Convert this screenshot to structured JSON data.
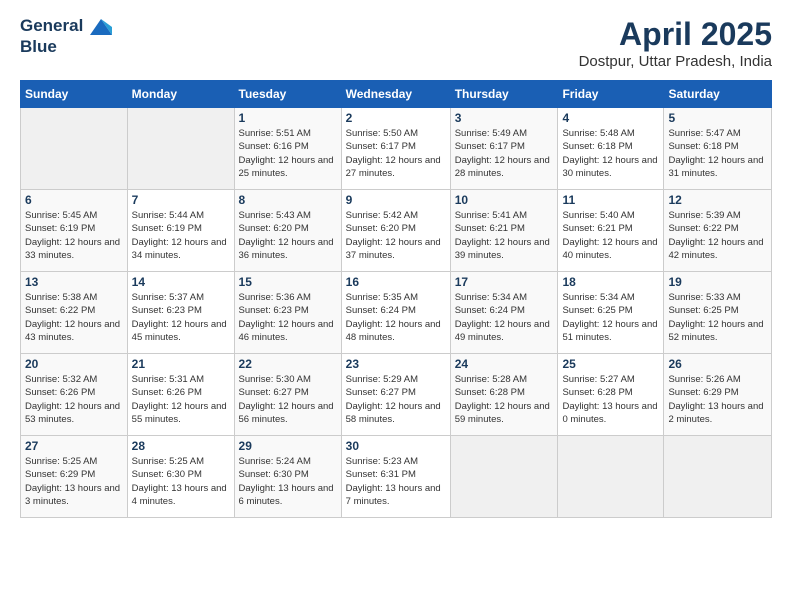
{
  "header": {
    "logo_line1": "General",
    "logo_line2": "Blue",
    "month_title": "April 2025",
    "location": "Dostpur, Uttar Pradesh, India"
  },
  "weekdays": [
    "Sunday",
    "Monday",
    "Tuesday",
    "Wednesday",
    "Thursday",
    "Friday",
    "Saturday"
  ],
  "weeks": [
    [
      {
        "day": "",
        "sunrise": "",
        "sunset": "",
        "daylight": ""
      },
      {
        "day": "",
        "sunrise": "",
        "sunset": "",
        "daylight": ""
      },
      {
        "day": "1",
        "sunrise": "Sunrise: 5:51 AM",
        "sunset": "Sunset: 6:16 PM",
        "daylight": "Daylight: 12 hours and 25 minutes."
      },
      {
        "day": "2",
        "sunrise": "Sunrise: 5:50 AM",
        "sunset": "Sunset: 6:17 PM",
        "daylight": "Daylight: 12 hours and 27 minutes."
      },
      {
        "day": "3",
        "sunrise": "Sunrise: 5:49 AM",
        "sunset": "Sunset: 6:17 PM",
        "daylight": "Daylight: 12 hours and 28 minutes."
      },
      {
        "day": "4",
        "sunrise": "Sunrise: 5:48 AM",
        "sunset": "Sunset: 6:18 PM",
        "daylight": "Daylight: 12 hours and 30 minutes."
      },
      {
        "day": "5",
        "sunrise": "Sunrise: 5:47 AM",
        "sunset": "Sunset: 6:18 PM",
        "daylight": "Daylight: 12 hours and 31 minutes."
      }
    ],
    [
      {
        "day": "6",
        "sunrise": "Sunrise: 5:45 AM",
        "sunset": "Sunset: 6:19 PM",
        "daylight": "Daylight: 12 hours and 33 minutes."
      },
      {
        "day": "7",
        "sunrise": "Sunrise: 5:44 AM",
        "sunset": "Sunset: 6:19 PM",
        "daylight": "Daylight: 12 hours and 34 minutes."
      },
      {
        "day": "8",
        "sunrise": "Sunrise: 5:43 AM",
        "sunset": "Sunset: 6:20 PM",
        "daylight": "Daylight: 12 hours and 36 minutes."
      },
      {
        "day": "9",
        "sunrise": "Sunrise: 5:42 AM",
        "sunset": "Sunset: 6:20 PM",
        "daylight": "Daylight: 12 hours and 37 minutes."
      },
      {
        "day": "10",
        "sunrise": "Sunrise: 5:41 AM",
        "sunset": "Sunset: 6:21 PM",
        "daylight": "Daylight: 12 hours and 39 minutes."
      },
      {
        "day": "11",
        "sunrise": "Sunrise: 5:40 AM",
        "sunset": "Sunset: 6:21 PM",
        "daylight": "Daylight: 12 hours and 40 minutes."
      },
      {
        "day": "12",
        "sunrise": "Sunrise: 5:39 AM",
        "sunset": "Sunset: 6:22 PM",
        "daylight": "Daylight: 12 hours and 42 minutes."
      }
    ],
    [
      {
        "day": "13",
        "sunrise": "Sunrise: 5:38 AM",
        "sunset": "Sunset: 6:22 PM",
        "daylight": "Daylight: 12 hours and 43 minutes."
      },
      {
        "day": "14",
        "sunrise": "Sunrise: 5:37 AM",
        "sunset": "Sunset: 6:23 PM",
        "daylight": "Daylight: 12 hours and 45 minutes."
      },
      {
        "day": "15",
        "sunrise": "Sunrise: 5:36 AM",
        "sunset": "Sunset: 6:23 PM",
        "daylight": "Daylight: 12 hours and 46 minutes."
      },
      {
        "day": "16",
        "sunrise": "Sunrise: 5:35 AM",
        "sunset": "Sunset: 6:24 PM",
        "daylight": "Daylight: 12 hours and 48 minutes."
      },
      {
        "day": "17",
        "sunrise": "Sunrise: 5:34 AM",
        "sunset": "Sunset: 6:24 PM",
        "daylight": "Daylight: 12 hours and 49 minutes."
      },
      {
        "day": "18",
        "sunrise": "Sunrise: 5:34 AM",
        "sunset": "Sunset: 6:25 PM",
        "daylight": "Daylight: 12 hours and 51 minutes."
      },
      {
        "day": "19",
        "sunrise": "Sunrise: 5:33 AM",
        "sunset": "Sunset: 6:25 PM",
        "daylight": "Daylight: 12 hours and 52 minutes."
      }
    ],
    [
      {
        "day": "20",
        "sunrise": "Sunrise: 5:32 AM",
        "sunset": "Sunset: 6:26 PM",
        "daylight": "Daylight: 12 hours and 53 minutes."
      },
      {
        "day": "21",
        "sunrise": "Sunrise: 5:31 AM",
        "sunset": "Sunset: 6:26 PM",
        "daylight": "Daylight: 12 hours and 55 minutes."
      },
      {
        "day": "22",
        "sunrise": "Sunrise: 5:30 AM",
        "sunset": "Sunset: 6:27 PM",
        "daylight": "Daylight: 12 hours and 56 minutes."
      },
      {
        "day": "23",
        "sunrise": "Sunrise: 5:29 AM",
        "sunset": "Sunset: 6:27 PM",
        "daylight": "Daylight: 12 hours and 58 minutes."
      },
      {
        "day": "24",
        "sunrise": "Sunrise: 5:28 AM",
        "sunset": "Sunset: 6:28 PM",
        "daylight": "Daylight: 12 hours and 59 minutes."
      },
      {
        "day": "25",
        "sunrise": "Sunrise: 5:27 AM",
        "sunset": "Sunset: 6:28 PM",
        "daylight": "Daylight: 13 hours and 0 minutes."
      },
      {
        "day": "26",
        "sunrise": "Sunrise: 5:26 AM",
        "sunset": "Sunset: 6:29 PM",
        "daylight": "Daylight: 13 hours and 2 minutes."
      }
    ],
    [
      {
        "day": "27",
        "sunrise": "Sunrise: 5:25 AM",
        "sunset": "Sunset: 6:29 PM",
        "daylight": "Daylight: 13 hours and 3 minutes."
      },
      {
        "day": "28",
        "sunrise": "Sunrise: 5:25 AM",
        "sunset": "Sunset: 6:30 PM",
        "daylight": "Daylight: 13 hours and 4 minutes."
      },
      {
        "day": "29",
        "sunrise": "Sunrise: 5:24 AM",
        "sunset": "Sunset: 6:30 PM",
        "daylight": "Daylight: 13 hours and 6 minutes."
      },
      {
        "day": "30",
        "sunrise": "Sunrise: 5:23 AM",
        "sunset": "Sunset: 6:31 PM",
        "daylight": "Daylight: 13 hours and 7 minutes."
      },
      {
        "day": "",
        "sunrise": "",
        "sunset": "",
        "daylight": ""
      },
      {
        "day": "",
        "sunrise": "",
        "sunset": "",
        "daylight": ""
      },
      {
        "day": "",
        "sunrise": "",
        "sunset": "",
        "daylight": ""
      }
    ]
  ]
}
